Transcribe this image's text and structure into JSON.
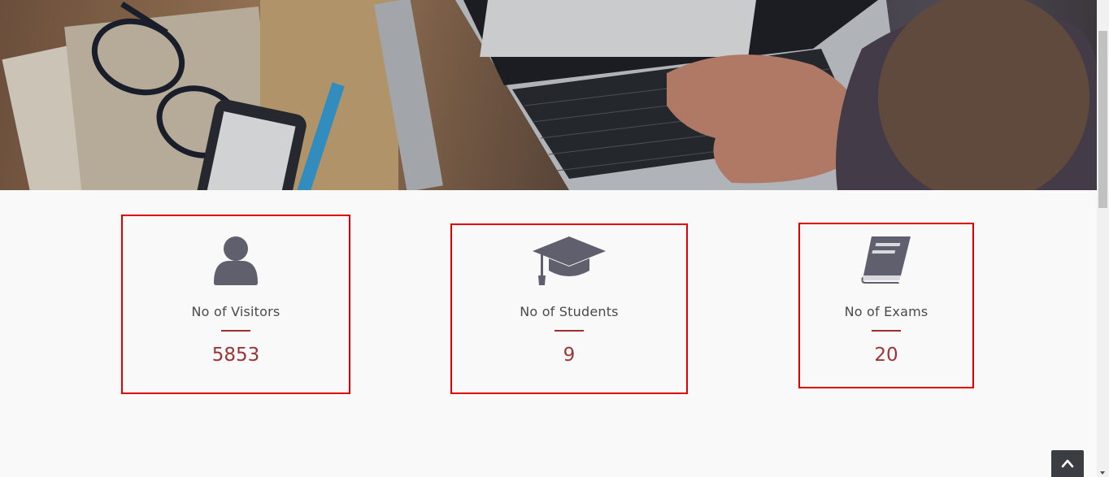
{
  "hero": {
    "image_name": "desk-laptop-photo"
  },
  "stats": [
    {
      "icon": "user-icon",
      "label": "No of Visitors",
      "value": "5853"
    },
    {
      "icon": "graduation-cap-icon",
      "label": "No of Students",
      "value": "9"
    },
    {
      "icon": "book-icon",
      "label": "No of Exams",
      "value": "20"
    }
  ],
  "colors": {
    "highlight_border": "#e00000",
    "value": "#9b3535",
    "icon": "#5f5f6e",
    "label": "#4a4a4a"
  },
  "back_to_top": {
    "icon": "chevron-up-icon"
  }
}
